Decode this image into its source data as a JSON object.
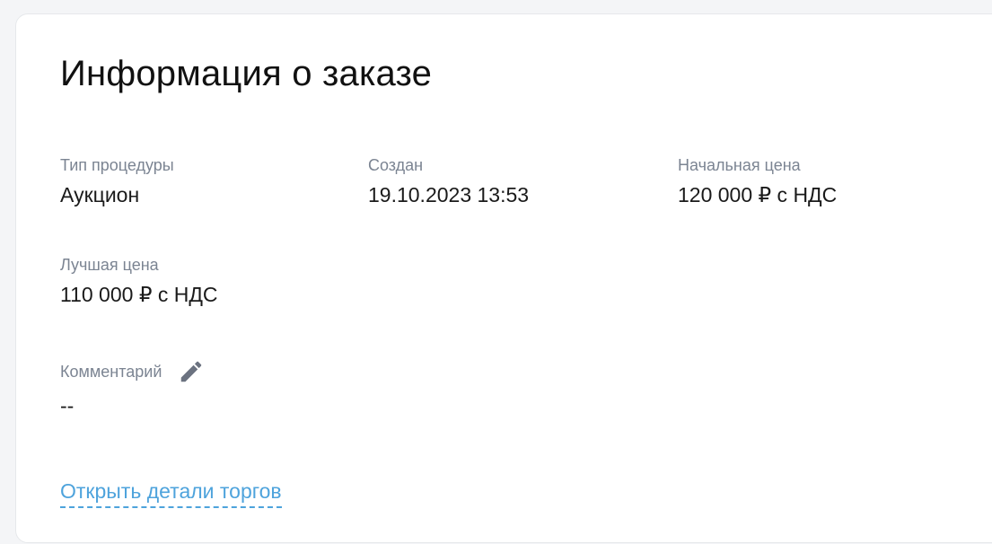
{
  "order_info": {
    "title": "Информация о заказе",
    "procedure_type": {
      "label": "Тип процедуры",
      "value": "Аукцион"
    },
    "created": {
      "label": "Создан",
      "value": "19.10.2023 13:53"
    },
    "initial_price": {
      "label": "Начальная цена",
      "value": "120 000 ₽ с НДС"
    },
    "best_price": {
      "label": "Лучшая цена",
      "value": "110 000 ₽ с НДС"
    },
    "comment": {
      "label": "Комментарий",
      "value": "--",
      "edit_icon": "pencil-icon"
    },
    "details_link": "Открыть детали торгов"
  },
  "colors": {
    "link": "#4ea3dc",
    "label": "#7b8492",
    "icon": "#6b7280"
  }
}
